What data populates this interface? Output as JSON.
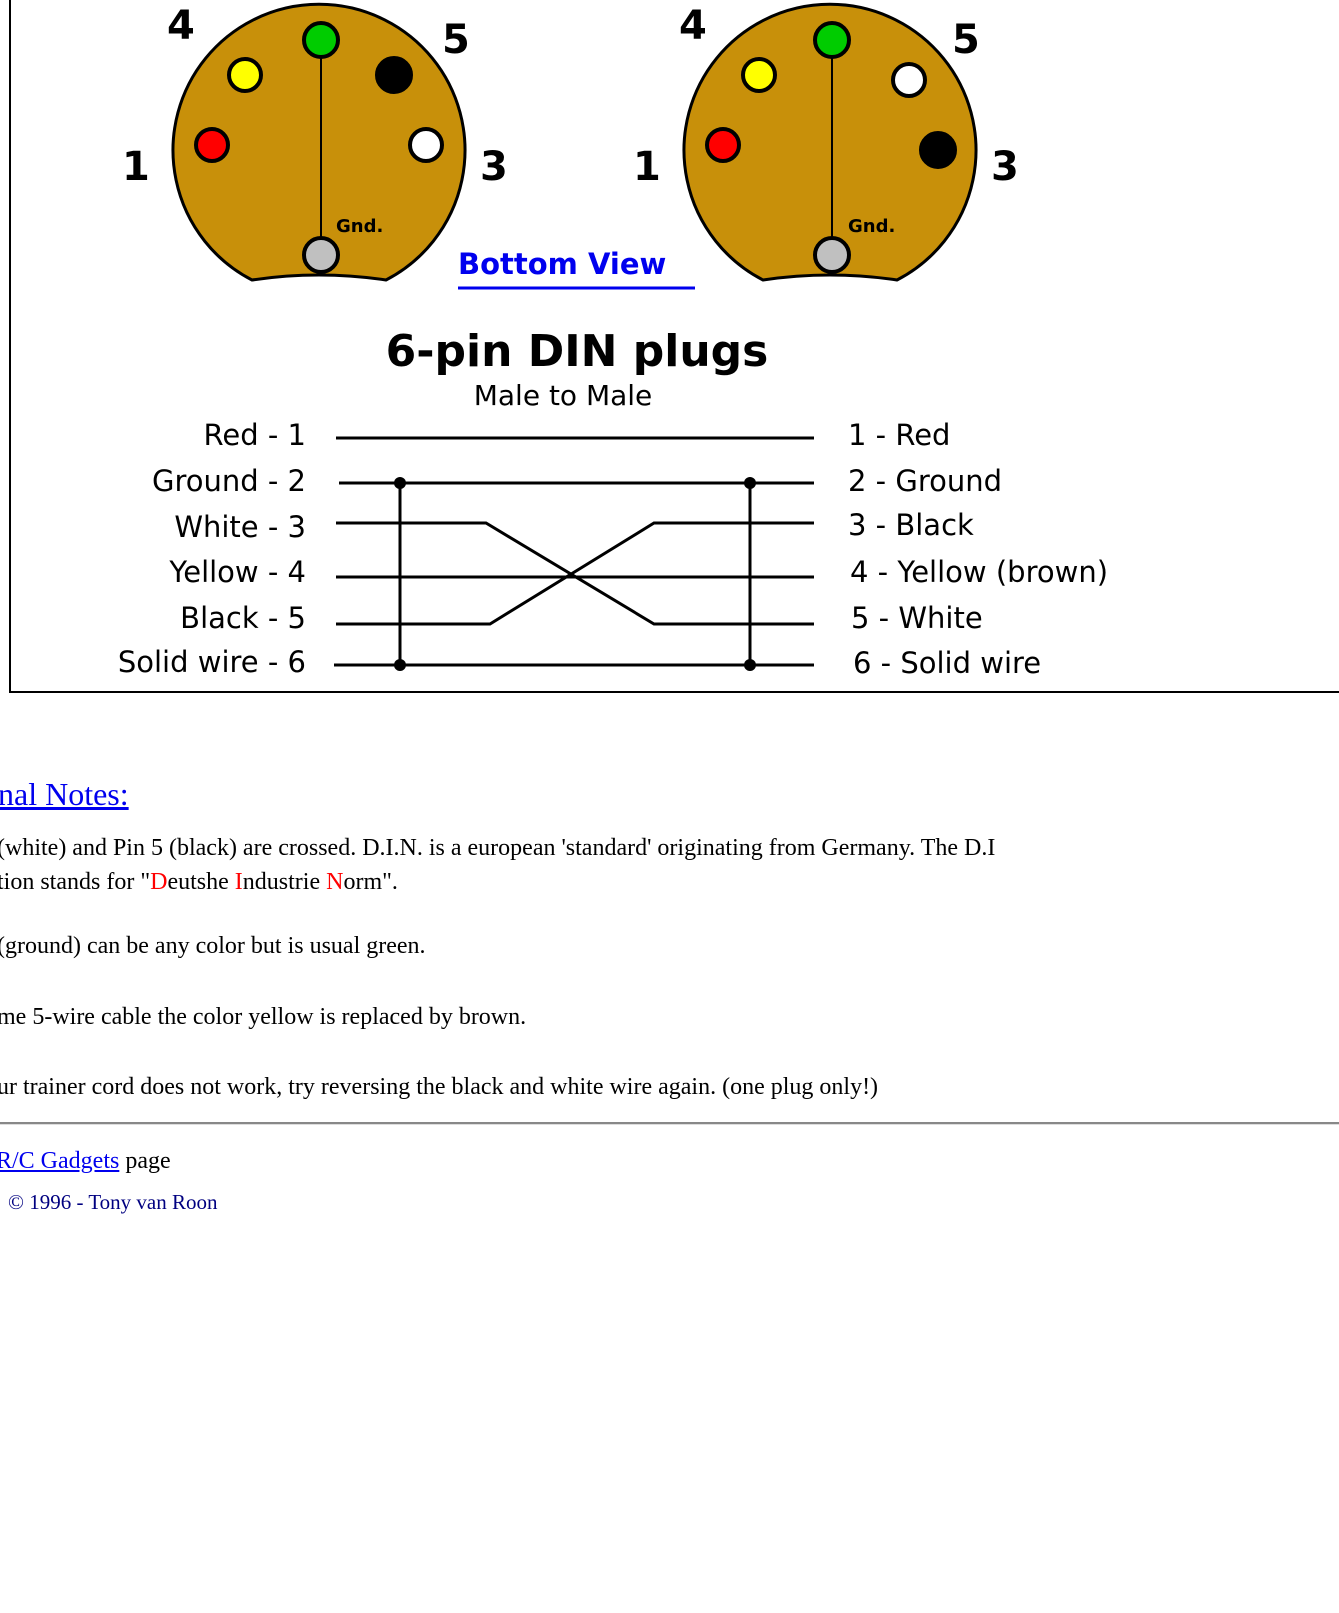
{
  "diagram": {
    "left_plug": {
      "pin_numbers": {
        "p4": "4",
        "p5": "5",
        "p1": "1",
        "p3": "3"
      },
      "gnd_label": "Gnd.",
      "pins": {
        "top": "#00cc00",
        "upper_left": "#ffff00",
        "upper_right": "#000000",
        "left": "#ff0000",
        "right": "#ffffff",
        "bottom": "#c0c0c0"
      }
    },
    "right_plug": {
      "pin_numbers": {
        "p4": "4",
        "p5": "5",
        "p1": "1",
        "p3": "3"
      },
      "gnd_label": "Gnd.",
      "pins": {
        "top": "#00cc00",
        "upper_left": "#ffff00",
        "upper_right": "#ffffff",
        "left": "#ff0000",
        "right": "#000000",
        "bottom": "#c0c0c0"
      }
    },
    "plug_color": "#c8900a",
    "view_label": "Bottom View",
    "title": "6-pin DIN plugs",
    "subtitle": "Male to Male",
    "left_labels": [
      "Red - 1",
      "Ground - 2",
      "White - 3",
      "Yellow - 4",
      "Black - 5",
      "Solid wire - 6"
    ],
    "right_labels": [
      "1 - Red",
      "2 - Ground",
      "3 - Black",
      "4 - Yellow (brown)",
      "5 - White",
      "6 - Solid wire"
    ]
  },
  "notes": {
    "heading": "onal Notes:",
    "note1_line1": "(white) and Pin 5 (black) are crossed. D.I.N. is a european 'standard' originating from Germany. The D.I",
    "note1_line2_pre": "tion stands for \"",
    "note1_D": "D",
    "note1_eutshe": "eutshe ",
    "note1_I": "I",
    "note1_ndustrie": "ndustrie ",
    "note1_N": "N",
    "note1_orm": "orm\".",
    "note2": "(ground) can be any color but is usual green.",
    "note3": "me 5-wire cable the color yellow is replaced by brown.",
    "note4": "ur trainer cord does not work, try reversing the black and white wire again. (one plug only!)"
  },
  "footer": {
    "back_link": "R/C Gadgets",
    "back_suffix": " page",
    "copyright": "© 1996 - Tony van Roon"
  }
}
